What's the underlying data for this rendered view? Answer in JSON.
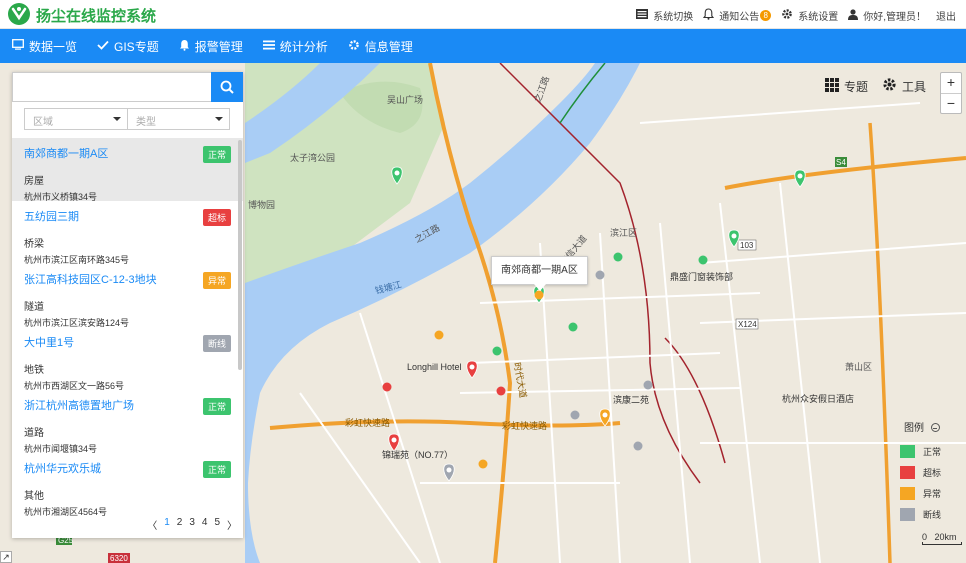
{
  "app": {
    "title": "扬尘在线监控系统"
  },
  "top_actions": [
    {
      "label": "系统切换",
      "icon": "switch-icon"
    },
    {
      "label": "通知公告",
      "icon": "bell-icon",
      "badge": "8"
    },
    {
      "label": "系统设置",
      "icon": "gear-icon"
    },
    {
      "label": "你好,管理员！",
      "icon": "user-icon"
    },
    {
      "label": "退出"
    }
  ],
  "nav": [
    {
      "label": "数据一览",
      "icon": "monitor-icon"
    },
    {
      "label": "GIS专题",
      "icon": "check-icon"
    },
    {
      "label": "报警管理",
      "icon": "bell-icon"
    },
    {
      "label": "统计分析",
      "icon": "list-icon"
    },
    {
      "label": "信息管理",
      "icon": "gear-icon"
    }
  ],
  "search": {
    "placeholder": "",
    "value": ""
  },
  "filters": {
    "region": "区域",
    "type": "类型"
  },
  "colors": {
    "accent": "#1a8af5",
    "normal": "#3cc46e",
    "over": "#e84040",
    "abnormal": "#f5a623",
    "offline": "#a0a6b0"
  },
  "sites": [
    {
      "name": "南郊商都一期A区",
      "type": "房屋",
      "address": "杭州市义桥镇34号",
      "status": "正常",
      "status_key": "normal"
    },
    {
      "name": "五纺园三期",
      "type": "桥梁",
      "address": "杭州市滨江区南环路345号",
      "status": "超标",
      "status_key": "over"
    },
    {
      "name": "张江高科技园区C-12-3地块",
      "type": "隧道",
      "address": "杭州市滨江区滨安路124号",
      "status": "异常",
      "status_key": "abnormal"
    },
    {
      "name": "大中里1号",
      "type": "地铁",
      "address": "杭州市西湖区文一路56号",
      "status": "断线",
      "status_key": "offline"
    },
    {
      "name": "浙江杭州高德置地广场",
      "type": "道路",
      "address": "杭州市闻堰镇34号",
      "status": "正常",
      "status_key": "normal"
    },
    {
      "name": "杭州华元欢乐城",
      "type": "其他",
      "address": "杭州市湘湖区4564号",
      "status": "正常",
      "status_key": "normal"
    }
  ],
  "pager": {
    "prev": "〈",
    "pages": [
      "1",
      "2",
      "3",
      "4",
      "5"
    ],
    "current": "1",
    "next": "〉"
  },
  "map_tools": {
    "topic": "专题",
    "tools": "工具",
    "zoom_in": "+",
    "zoom_out": "−"
  },
  "popup": {
    "label": "南郊商都一期A区"
  },
  "legend": {
    "title": "图例",
    "items": [
      {
        "label": "正常",
        "color": "#3cc46e"
      },
      {
        "label": "超标",
        "color": "#e84040"
      },
      {
        "label": "异常",
        "color": "#f5a623"
      },
      {
        "label": "断线",
        "color": "#a0a6b0"
      }
    ]
  },
  "scale": {
    "start": "0",
    "end": "20km"
  },
  "map_labels": {
    "qiantang": "钱塘江",
    "binjiang": "滨江区",
    "xiaoshan": "萧山区",
    "longhill": "Longhill Hotel",
    "binkang": "滨康二苑",
    "ruiyuan": "锦瑞苑（NO.77）",
    "dingsheng": "鼎盛门窗装饰部",
    "hubin": "杭州众安假日酒店",
    "taiziwan": "太子湾公园",
    "wushan": "吴山广场",
    "caihong1": "彩虹快速路",
    "caihong2": "彩虹快速路",
    "zhijiang": "之江路",
    "shidai": "时代大道",
    "s4": "S4",
    "x124": "X124",
    "s103": "103",
    "g6320": "6320",
    "g25": "G25",
    "zhijiang2": "之江路",
    "museum": "博物园",
    "dongxin": "东信大道"
  },
  "markers": [
    {
      "status": "normal",
      "kind": "pin"
    },
    {
      "status": "normal",
      "kind": "pin"
    },
    {
      "status": "normal",
      "kind": "pin"
    },
    {
      "status": "normal",
      "kind": "pin"
    },
    {
      "status": "over",
      "kind": "pin"
    },
    {
      "status": "over",
      "kind": "pin"
    },
    {
      "status": "abnormal",
      "kind": "pin"
    },
    {
      "status": "offline",
      "kind": "pin"
    },
    {
      "status": "normal",
      "kind": "dot"
    },
    {
      "status": "normal",
      "kind": "dot"
    },
    {
      "status": "normal",
      "kind": "dot"
    },
    {
      "status": "normal",
      "kind": "dot"
    },
    {
      "status": "over",
      "kind": "dot"
    },
    {
      "status": "over",
      "kind": "dot"
    },
    {
      "status": "abnormal",
      "kind": "dot"
    },
    {
      "status": "abnormal",
      "kind": "dot"
    },
    {
      "status": "abnormal",
      "kind": "dot"
    },
    {
      "status": "offline",
      "kind": "dot"
    },
    {
      "status": "offline",
      "kind": "dot"
    },
    {
      "status": "offline",
      "kind": "dot"
    },
    {
      "status": "offline",
      "kind": "dot"
    }
  ]
}
